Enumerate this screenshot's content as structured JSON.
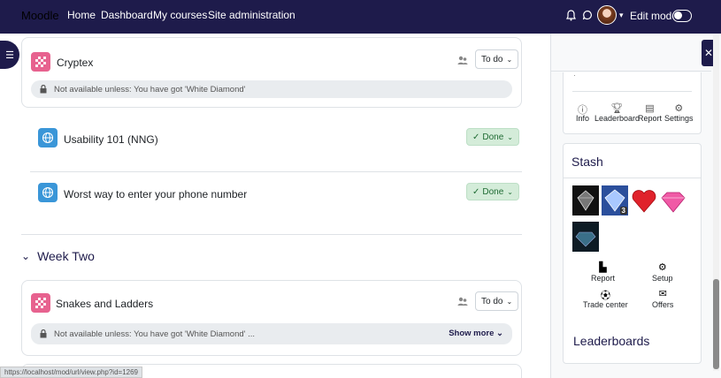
{
  "nav": {
    "brand": "Moodle",
    "links": [
      "Home",
      "Dashboard",
      "My courses",
      "Site administration"
    ],
    "edit_mode_label": "Edit mode"
  },
  "activities": [
    {
      "name": "Cryptex",
      "status": "To do",
      "restriction": "Not available unless: You have got 'White Diamond'"
    },
    {
      "name": "Usability 101 (NNG)",
      "status": "Done"
    },
    {
      "name": "Worst way to enter your phone number",
      "status": "Done"
    },
    {
      "name": "Snakes and Ladders",
      "status": "To do",
      "restriction": "Not available unless: You have got 'White Diamond' ...",
      "show_more": "Show more"
    }
  ],
  "section": {
    "title": "Week Two"
  },
  "sidebar": {
    "block_nav": [
      {
        "label": "Info",
        "icon": "info-icon"
      },
      {
        "label": "Leaderboard",
        "icon": "trophy-icon"
      },
      {
        "label": "Report",
        "icon": "report-icon"
      },
      {
        "label": "Settings",
        "icon": "gear-icon"
      }
    ],
    "stash": {
      "title": "Stash",
      "item_badge": "3",
      "actions": [
        {
          "label": "Report",
          "icon": "chart-icon"
        },
        {
          "label": "Setup",
          "icon": "gear-icon"
        },
        {
          "label": "Trade center",
          "icon": "soccer-ball-icon"
        },
        {
          "label": "Offers",
          "icon": "envelope-icon"
        }
      ]
    },
    "leaderboards_title": "Leaderboards"
  },
  "status_url": "https://localhost/mod/url/view.php?id=1269"
}
